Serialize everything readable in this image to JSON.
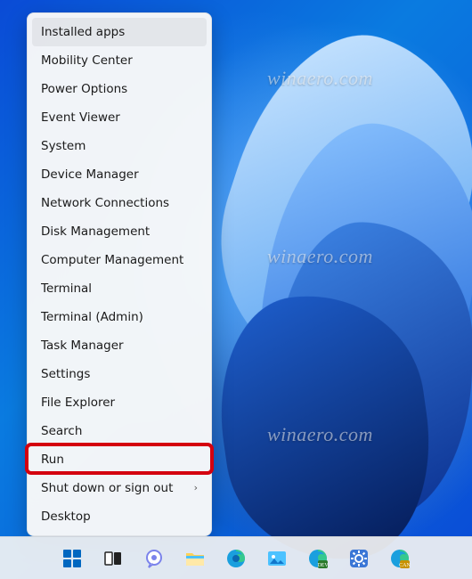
{
  "menu": {
    "items": [
      {
        "label": "Installed apps",
        "submenu": false,
        "hovered": true,
        "highlighted": false
      },
      {
        "label": "Mobility Center",
        "submenu": false,
        "hovered": false,
        "highlighted": false
      },
      {
        "label": "Power Options",
        "submenu": false,
        "hovered": false,
        "highlighted": false
      },
      {
        "label": "Event Viewer",
        "submenu": false,
        "hovered": false,
        "highlighted": false
      },
      {
        "label": "System",
        "submenu": false,
        "hovered": false,
        "highlighted": false
      },
      {
        "label": "Device Manager",
        "submenu": false,
        "hovered": false,
        "highlighted": false
      },
      {
        "label": "Network Connections",
        "submenu": false,
        "hovered": false,
        "highlighted": false
      },
      {
        "label": "Disk Management",
        "submenu": false,
        "hovered": false,
        "highlighted": false
      },
      {
        "label": "Computer Management",
        "submenu": false,
        "hovered": false,
        "highlighted": false
      },
      {
        "label": "Terminal",
        "submenu": false,
        "hovered": false,
        "highlighted": false
      },
      {
        "label": "Terminal (Admin)",
        "submenu": false,
        "hovered": false,
        "highlighted": false
      },
      {
        "label": "Task Manager",
        "submenu": false,
        "hovered": false,
        "highlighted": false
      },
      {
        "label": "Settings",
        "submenu": false,
        "hovered": false,
        "highlighted": false
      },
      {
        "label": "File Explorer",
        "submenu": false,
        "hovered": false,
        "highlighted": false
      },
      {
        "label": "Search",
        "submenu": false,
        "hovered": false,
        "highlighted": false
      },
      {
        "label": "Run",
        "submenu": false,
        "hovered": false,
        "highlighted": true
      },
      {
        "label": "Shut down or sign out",
        "submenu": true,
        "hovered": false,
        "highlighted": false
      },
      {
        "label": "Desktop",
        "submenu": false,
        "hovered": false,
        "highlighted": false
      }
    ]
  },
  "watermark": {
    "text": "winaero.com"
  },
  "taskbar": {
    "icons": [
      "start-icon",
      "task-view-icon",
      "chat-icon",
      "file-explorer-icon",
      "edge-icon",
      "photos-icon",
      "edge-dev-icon",
      "settings-app-icon",
      "edge-canary-icon"
    ]
  }
}
